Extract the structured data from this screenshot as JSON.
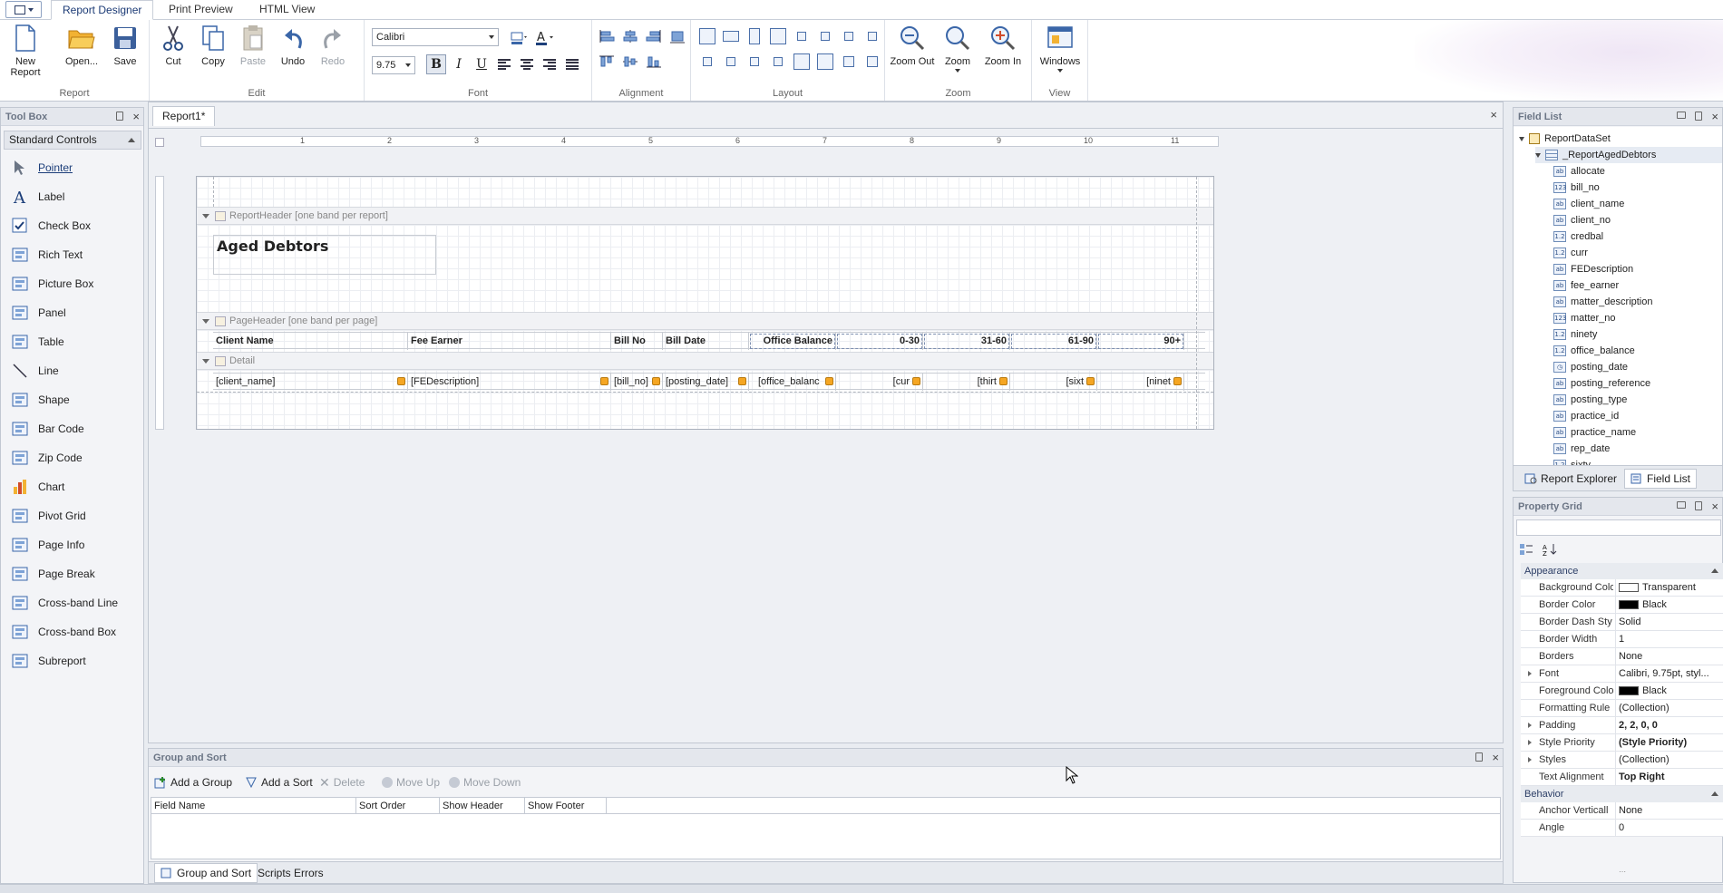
{
  "ribbon": {
    "tabs": [
      "Report Designer",
      "Print Preview",
      "HTML View"
    ],
    "groups": {
      "report": {
        "label": "Report",
        "buttons": [
          "New Report",
          "Open...",
          "Save"
        ]
      },
      "edit": {
        "label": "Edit",
        "buttons": [
          "Cut",
          "Copy",
          "Paste",
          "Undo",
          "Redo"
        ]
      },
      "font": {
        "label": "Font",
        "family": "Calibri",
        "size": "9.75"
      },
      "alignment": {
        "label": "Alignment"
      },
      "layout": {
        "label": "Layout"
      },
      "zoom": {
        "label": "Zoom",
        "buttons": [
          "Zoom Out",
          "Zoom",
          "Zoom In"
        ]
      },
      "view": {
        "label": "View",
        "buttons": [
          "Windows"
        ]
      }
    }
  },
  "toolbox": {
    "title": "Tool Box",
    "group": "Standard Controls",
    "items": [
      "Pointer",
      "Label",
      "Check Box",
      "Rich Text",
      "Picture Box",
      "Panel",
      "Table",
      "Line",
      "Shape",
      "Bar Code",
      "Zip Code",
      "Chart",
      "Pivot Grid",
      "Page Info",
      "Page Break",
      "Cross-band Line",
      "Cross-band Box",
      "Subreport"
    ]
  },
  "document": {
    "tab": "Report1*",
    "ruler_marks": [
      "1",
      "2",
      "3",
      "4",
      "5",
      "6",
      "7",
      "8",
      "9",
      "10",
      "11"
    ],
    "bands": {
      "report_header": "ReportHeader [one band per report]",
      "page_header": "PageHeader [one band per page]",
      "detail": "Detail"
    },
    "title_label": "Aged Debtors",
    "header_cells": [
      "Client Name",
      "Fee Earner",
      "Bill No",
      "Bill Date",
      "Office Balance",
      "0-30",
      "31-60",
      "61-90",
      "90+"
    ],
    "detail_cells": [
      "[client_name]",
      "[FEDescription]",
      "[bill_no]",
      "[posting_date]",
      "[office_balanc",
      "[cur",
      "[thirt",
      "[sixt",
      "[ninet"
    ]
  },
  "fieldlist": {
    "title": "Field List",
    "dataset": "ReportDataSet",
    "table": "_ReportAgedDebtors",
    "fields": [
      {
        "name": "allocate",
        "icon": "ab"
      },
      {
        "name": "bill_no",
        "icon": "123"
      },
      {
        "name": "client_name",
        "icon": "ab"
      },
      {
        "name": "client_no",
        "icon": "ab"
      },
      {
        "name": "credbal",
        "icon": "1.2"
      },
      {
        "name": "curr",
        "icon": "1.2"
      },
      {
        "name": "FEDescription",
        "icon": "ab"
      },
      {
        "name": "fee_earner",
        "icon": "ab"
      },
      {
        "name": "matter_description",
        "icon": "ab"
      },
      {
        "name": "matter_no",
        "icon": "123"
      },
      {
        "name": "ninety",
        "icon": "1.2"
      },
      {
        "name": "office_balance",
        "icon": "1.2"
      },
      {
        "name": "posting_date",
        "icon": "clock"
      },
      {
        "name": "posting_reference",
        "icon": "ab"
      },
      {
        "name": "posting_type",
        "icon": "ab"
      },
      {
        "name": "practice_id",
        "icon": "ab"
      },
      {
        "name": "practice_name",
        "icon": "ab"
      },
      {
        "name": "rep_date",
        "icon": "ab"
      },
      {
        "name": "sixty",
        "icon": "1.2"
      }
    ],
    "tabs": [
      "Report Explorer",
      "Field List"
    ]
  },
  "propgrid": {
    "title": "Property Grid",
    "categories": [
      "Appearance",
      "Behavior"
    ],
    "appearance": [
      {
        "name": "Background Colo",
        "value": "Transparent",
        "swatch": "#ffffff"
      },
      {
        "name": "Border Color",
        "value": "Black",
        "swatch": "#000000"
      },
      {
        "name": "Border Dash Sty",
        "value": "Solid"
      },
      {
        "name": "Border Width",
        "value": "1"
      },
      {
        "name": "Borders",
        "value": "None"
      },
      {
        "name": "Font",
        "value": "Calibri, 9.75pt, styl...",
        "expand": true
      },
      {
        "name": "Foreground Colo",
        "value": "Black",
        "swatch": "#000000"
      },
      {
        "name": "Formatting Rule",
        "value": "(Collection)"
      },
      {
        "name": "Padding",
        "value": "2, 2, 0, 0",
        "expand": true,
        "bold": true
      },
      {
        "name": "Style Priority",
        "value": "(Style Priority)",
        "expand": true,
        "bold": true
      },
      {
        "name": "Styles",
        "value": "(Collection)",
        "expand": true
      },
      {
        "name": "Text Alignment",
        "value": "Top Right",
        "bold": true
      }
    ],
    "behavior": [
      {
        "name": "Anchor Verticall",
        "value": "None"
      },
      {
        "name": "Angle",
        "value": "0"
      }
    ]
  },
  "groupsort": {
    "title": "Group and Sort",
    "tools": [
      "Add a Group",
      "Add a Sort",
      "Delete",
      "Move Up",
      "Move Down"
    ],
    "columns": [
      "Field Name",
      "Sort Order",
      "Show Header",
      "Show Footer"
    ],
    "tabs": [
      "Group and Sort",
      "Scripts Errors"
    ]
  }
}
